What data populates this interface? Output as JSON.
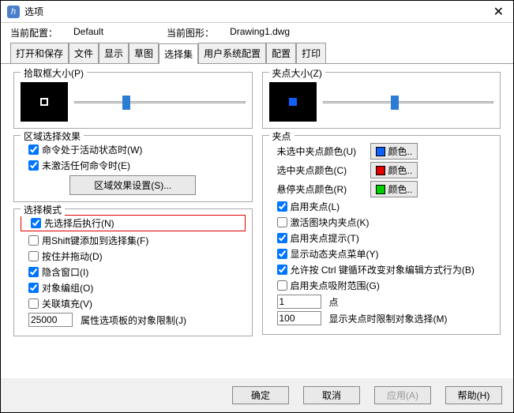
{
  "window": {
    "title": "选项"
  },
  "config": {
    "current_config_label": "当前配置：",
    "current_config_value": "Default",
    "current_drawing_label": "当前图形：",
    "current_drawing_value": "Drawing1.dwg"
  },
  "tabs": [
    "打开和保存",
    "文件",
    "显示",
    "草图",
    "选择集",
    "用户系统配置",
    "配置",
    "打印"
  ],
  "left": {
    "pickbox": {
      "title": "拾取框大小(P)"
    },
    "area_effect": {
      "title": "区域选择效果",
      "active_cmd": "命令处于活动状态时(W)",
      "no_cmd": "未激活任何命令时(E)",
      "settings_btn": "区域效果设置(S)..."
    },
    "mode": {
      "title": "选择模式",
      "presel": "先选择后执行(N)",
      "shift": "用Shift键添加到选择集(F)",
      "pressdrag": "按住并拖动(D)",
      "implied": "隐含窗口(I)",
      "group": "对象编组(O)",
      "hatch": "关联填充(V)",
      "limit_value": "25000",
      "limit_label": "属性选项板的对象限制(J)"
    }
  },
  "right": {
    "gripsize": {
      "title": "夹点大小(Z)"
    },
    "grips": {
      "title": "夹点",
      "unsel": "未选中夹点颜色(U)",
      "sel": "选中夹点颜色(C)",
      "hover": "悬停夹点颜色(R)",
      "color_btn": "颜色..",
      "c_unsel": "#1060ff",
      "c_sel": "#e00000",
      "c_hover": "#00d000",
      "enable": "启用夹点(L)",
      "block": "激活图块内夹点(K)",
      "tips": "启用夹点提示(T)",
      "dyn": "显示动态夹点菜单(Y)",
      "ctrl": "允许按 Ctrl 键循环改变对象编辑方式行为(B)",
      "snap": "启用夹点吸附范围(G)",
      "snap_value": "1",
      "snap_unit": "点",
      "limit_value": "100",
      "limit_label": "显示夹点时限制对象选择(M)"
    }
  },
  "footer": {
    "ok": "确定",
    "cancel": "取消",
    "apply": "应用(A)",
    "help": "帮助(H)"
  }
}
